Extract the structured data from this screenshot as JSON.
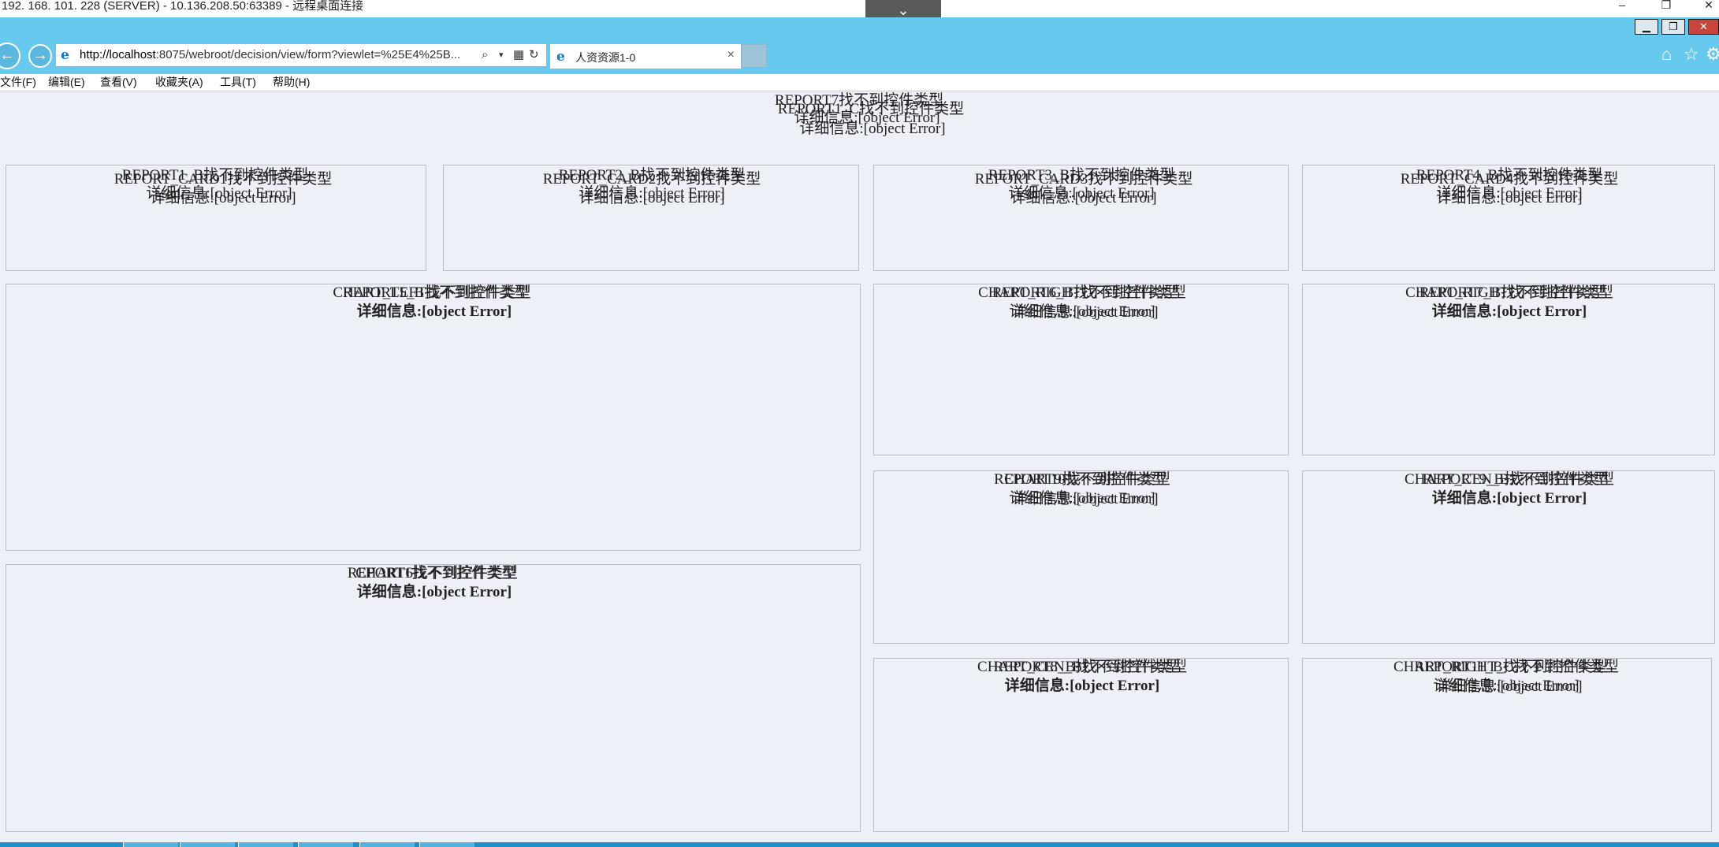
{
  "rdp": {
    "title": "192. 168. 101. 228 (SERVER) - 10.136.208.50:63389 - 远程桌面连接",
    "pin_icon": "chevron-down-icon",
    "minimize": "–",
    "restore": "❐",
    "close": "✕"
  },
  "window": {
    "minimize": "▁",
    "restore": "❐",
    "close": "✕"
  },
  "browser": {
    "address_host": "http://localhost",
    "address_rest": ":8075/webroot/decision/view/form?viewlet=%25E4%25B...",
    "tab_label": "人资资源1-0",
    "tab_close": "×",
    "icons": [
      "home-icon",
      "star-icon",
      "gear-icon"
    ]
  },
  "menu": [
    "文件(F)",
    "编辑(E)",
    "查看(V)",
    "收藏夹(A)",
    "工具(T)",
    "帮助(H)"
  ],
  "top_report": {
    "l1": "REPORT7找不到控件类型",
    "l2": "REPORT1_C找不到控件类型",
    "l3": "详细信息:[object Error]",
    "l4": "详细信息:[object Error]"
  },
  "cards": [
    {
      "a": "REPORT1_B找不到控件类型",
      "b": "REPORT_CARD1找不到控件类型",
      "c": "详细信息:[object Error]",
      "d": "详细信息:[object Error]"
    },
    {
      "a": "REPORT2_B找不到控件类型",
      "b": "REPORT_CARD2找不到控件类型",
      "c": "详细信息:[object Error]",
      "d": "详细信息:[object Error]"
    },
    {
      "a": "REPORT3_B找不到控件类型",
      "b": "REPORT_CARD3找不到控件类型",
      "c": "详细信息:[object Error]",
      "d": "详细信息:[object Error]"
    },
    {
      "a": "REPORT4_B找不到控件类型",
      "b": "REPORT_CARD4找不到控件类型",
      "c": "详细信息:[object Error]",
      "d": "详细信息:[object Error]"
    }
  ],
  "left_top": {
    "a": "CHART_LEFT找不到控件类型",
    "b": "REPORT5_B找不到控件类型",
    "c": "详细信息:[object Error]"
  },
  "left_bottom": {
    "a": "REPORT1找不到控件类型",
    "b": "CHART6找不到控件类型",
    "c": "详细信息:[object Error]"
  },
  "grid": [
    {
      "a": "CHART_RIGHT找不到控件类型",
      "b": "REPORT6_B找不到控件类型",
      "c": "详细信息:[object Error]",
      "d": "详细信息:[object Error]"
    },
    {
      "a": "CHART_RIGHT找不到控件类型",
      "b": "REPORT7_B找不到控件类型",
      "c": "详细信息:[object Error]"
    },
    {
      "a": "REPORT10找不到控件类型",
      "b": "CHART9找不到控件类型",
      "c": "详细信息:[object Error]",
      "d": "详细信息:[object Error]"
    },
    {
      "a": "CHART_CEN_B找不到控件类型",
      "b": "REPORT9_B找不到控件类型",
      "c": "详细信息:[object Error]"
    },
    {
      "a": "CHART_CEN_B找不到控件类型",
      "b": "REPORT8_B找不到控件类型",
      "c": "详细信息:[object Error]"
    },
    {
      "a": "CHART_RIGHT_C找不到控件类型",
      "b": "REPORT11_B找不到控件类型",
      "c": "详细信息:[object Error]",
      "d": "详细信息:[object Error]"
    }
  ]
}
